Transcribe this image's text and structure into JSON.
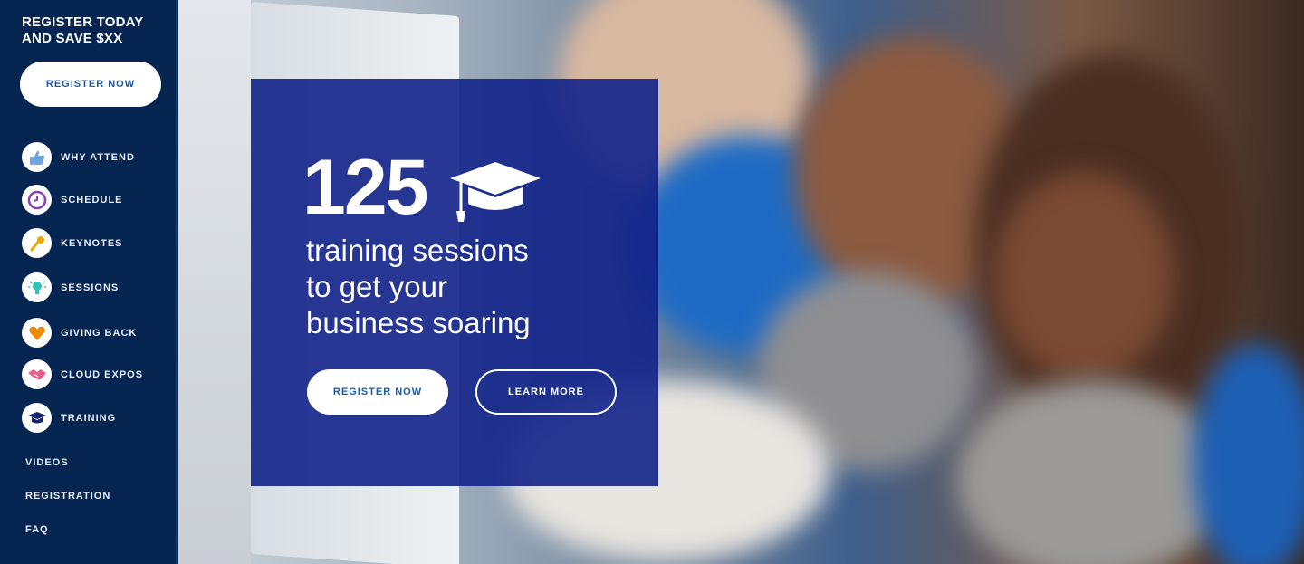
{
  "sidebar": {
    "promo_line1": "REGISTER TODAY",
    "promo_line2": "AND SAVE $XX",
    "register_label": "REGISTER NOW",
    "nav": [
      {
        "label": "WHY ATTEND",
        "icon": "thumbs-up-icon"
      },
      {
        "label": "SCHEDULE",
        "icon": "clock-icon"
      },
      {
        "label": "KEYNOTES",
        "icon": "microphone-icon"
      },
      {
        "label": "SESSIONS",
        "icon": "lightbulb-icon"
      },
      {
        "label": "GIVING BACK",
        "icon": "heart-icon"
      },
      {
        "label": "CLOUD EXPOS",
        "icon": "handshake-icon"
      },
      {
        "label": "TRAINING",
        "icon": "graduation-cap-icon"
      }
    ],
    "links": [
      "VIDEOS",
      "REGISTRATION",
      "FAQ"
    ]
  },
  "hero": {
    "number": "125",
    "headline_line1": "training sessions",
    "headline_line2": "to get your",
    "headline_line3": "business soaring",
    "register_label": "REGISTER NOW",
    "learn_more_label": "LEARN MORE"
  },
  "colors": {
    "sidebar_bg": "#062550",
    "overlay_bg": "#122288",
    "button_text": "#1b5aa6"
  }
}
